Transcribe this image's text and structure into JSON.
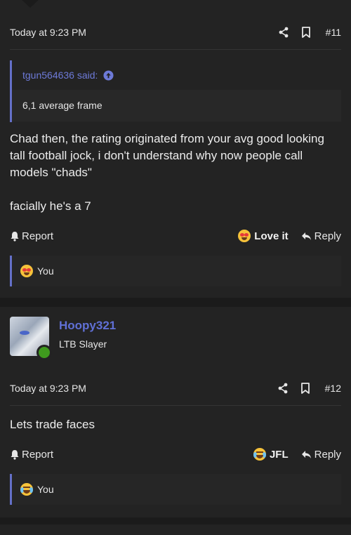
{
  "posts": [
    {
      "date": "Today at 9:23 PM",
      "number": "#11",
      "quote": {
        "author_line": "tgun564636 said:",
        "text": "6,1 average frame"
      },
      "body_lines": [
        "Chad then, the rating originated from your avg good looking",
        "tall football jock, i don't understand why now people call",
        "models \"chads\"",
        "",
        "facially he's a 7"
      ],
      "actions": {
        "report": "Report",
        "reaction": "Love it",
        "reaction_icon": "heart-eyes-emoji-icon",
        "reply": "Reply"
      },
      "reactions_summary": {
        "icon": "heart-eyes-emoji-icon",
        "text": "You"
      }
    },
    {
      "author": {
        "name": "Hoopy321",
        "title": "LTB Slayer",
        "online": true
      },
      "date": "Today at 9:23 PM",
      "number": "#12",
      "body_lines": [
        "Lets trade faces"
      ],
      "actions": {
        "report": "Report",
        "reaction": "JFL",
        "reaction_icon": "tears-of-joy-emoji-icon",
        "reply": "Reply"
      },
      "reactions_summary": {
        "icon": "tears-of-joy-emoji-icon",
        "text": "You"
      }
    }
  ],
  "colors": {
    "background": "#1b1b1b",
    "post_background": "#232323",
    "accent": "#6470c8",
    "online": "#3f9a1e"
  }
}
